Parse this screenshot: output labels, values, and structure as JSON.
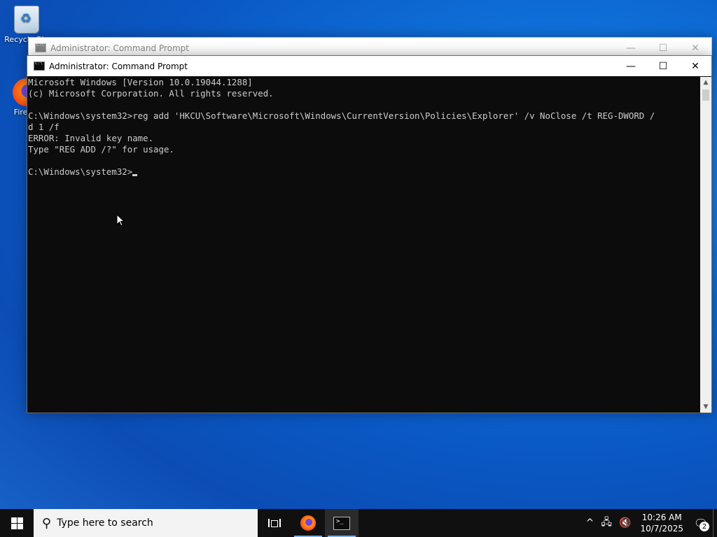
{
  "desktop": {
    "icons": [
      {
        "label": "Recycle Bin",
        "icon": "recycle-bin-icon"
      },
      {
        "label": "Firefox",
        "icon": "firefox-icon"
      }
    ]
  },
  "back_window": {
    "title": "Administrator: Command Prompt",
    "minimize": "—",
    "maximize": "☐",
    "close": "✕"
  },
  "window": {
    "title": "Administrator: Command Prompt",
    "minimize": "—",
    "maximize": "☐",
    "close": "✕"
  },
  "console": {
    "lines": [
      "Microsoft Windows [Version 10.0.19044.1288]",
      "(c) Microsoft Corporation. All rights reserved.",
      "",
      "C:\\Windows\\system32>reg add 'HKCU\\Software\\Microsoft\\Windows\\CurrentVersion\\Policies\\Explorer' /v NoClose /t REG-DWORD /",
      "d 1 /f",
      "ERROR: Invalid key name.",
      "Type \"REG ADD /?\" for usage.",
      ""
    ],
    "prompt": "C:\\Windows\\system32>"
  },
  "scrollbar": {
    "up": "▲",
    "down": "▼"
  },
  "taskbar": {
    "search_placeholder": "Type here to search",
    "search_icon": "⚲",
    "tray": {
      "chevron": "^",
      "network_icon": "🖧",
      "volume_icon": "🔇",
      "time": "10:26 AM",
      "date": "10/7/2025",
      "notification_icon": "🗨",
      "notification_count": "2"
    }
  }
}
